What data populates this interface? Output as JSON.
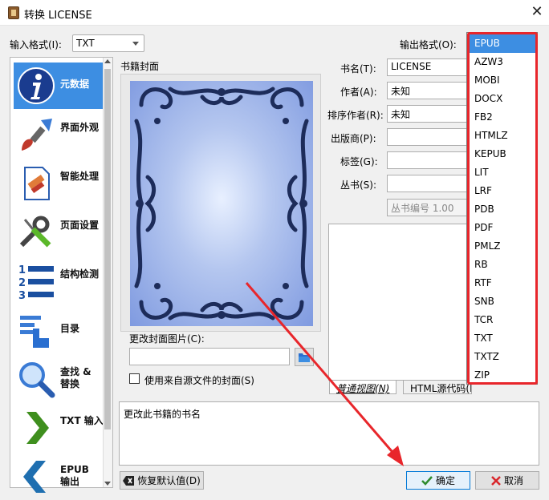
{
  "window": {
    "title": "转换 LICENSE",
    "close_glyph": "✕"
  },
  "input_format": {
    "label": "输入格式(I):",
    "value": "TXT"
  },
  "output_format": {
    "label": "输出格式(O):"
  },
  "sidebar": {
    "items": [
      {
        "label": "元数据",
        "icon": "info-icon",
        "selected": true
      },
      {
        "label": "界面外观",
        "icon": "brush-icon"
      },
      {
        "label": "智能处理",
        "icon": "document-icon"
      },
      {
        "label": "页面设置",
        "icon": "wrench-screwdriver-icon"
      },
      {
        "label": "结构检测",
        "icon": "numbered-list-icon"
      },
      {
        "label": "目录",
        "icon": "toc-icon"
      },
      {
        "label": "查找 &\n替换",
        "icon": "magnifier-icon"
      },
      {
        "label": "TXT 输入",
        "icon": "arrow-right-icon"
      },
      {
        "label": "EPUB\n输出",
        "icon": "arrow-left-icon"
      }
    ]
  },
  "cover": {
    "section_label": "书籍封面",
    "change_label": "更改封面图片(C):",
    "path_value": "",
    "use_source_label": "使用来自源文件的封面(S)",
    "use_source_checked": false
  },
  "metadata": {
    "title_label": "书名(T):",
    "title_value": "LICENSE",
    "author_label": "作者(A):",
    "author_value": "未知",
    "sort_author_label": "排序作者(R):",
    "sort_author_value": "未知",
    "publisher_label": "出版商(P):",
    "publisher_value": "",
    "tags_label": "标签(G):",
    "tags_value": "",
    "series_label": "丛书(S):",
    "series_value": "",
    "series_index_placeholder": "丛书编号 1.00"
  },
  "comments": {
    "tab_normal": "普通视图(N)",
    "tab_html": "HTML源代码(H)",
    "hint": "更改此书籍的书名"
  },
  "output_formats": {
    "options": [
      "EPUB",
      "AZW3",
      "MOBI",
      "DOCX",
      "FB2",
      "HTMLZ",
      "KEPUB",
      "LIT",
      "LRF",
      "PDB",
      "PDF",
      "PMLZ",
      "RB",
      "RTF",
      "SNB",
      "TCR",
      "TXT",
      "TXTZ",
      "ZIP"
    ],
    "selected": "EPUB"
  },
  "buttons": {
    "restore_defaults": "恢复默认值(D)",
    "ok": "确定",
    "cancel": "取消"
  },
  "colors": {
    "accent": "#3d8ee2",
    "highlight_red": "#e8262b"
  }
}
